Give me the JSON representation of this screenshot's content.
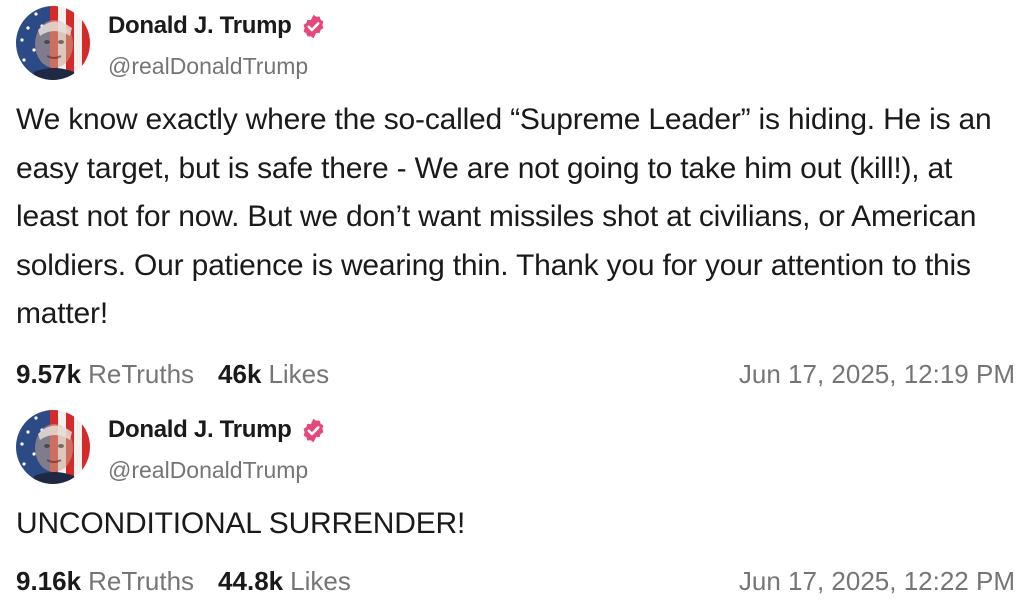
{
  "posts": [
    {
      "author": {
        "display_name": "Donald J. Trump",
        "handle": "@realDonaldTrump",
        "verified": true,
        "avatar_icon": "flag-portrait-avatar"
      },
      "body": "We know exactly where the so-called “Supreme Leader” is hiding. He is an easy target, but is safe there - We are not going to take him out (kill!), at least not for now. But we don’t want missiles shot at civilians, or American soldiers. Our patience is wearing thin. Thank you for your attention to this matter!",
      "retruths_count": "9.57k",
      "retruths_label": "ReTruths",
      "likes_count": "46k",
      "likes_label": "Likes",
      "timestamp": "Jun 17, 2025, 12:19 PM"
    },
    {
      "author": {
        "display_name": "Donald J. Trump",
        "handle": "@realDonaldTrump",
        "verified": true,
        "avatar_icon": "flag-portrait-avatar"
      },
      "body": "UNCONDITIONAL SURRENDER!",
      "retruths_count": "9.16k",
      "retruths_label": "ReTruths",
      "likes_count": "44.8k",
      "likes_label": "Likes",
      "timestamp": "Jun 17, 2025, 12:22 PM"
    }
  ],
  "colors": {
    "verified_badge": "#e5487a",
    "secondary_text": "#757575",
    "primary_text": "#1a1a1a"
  }
}
